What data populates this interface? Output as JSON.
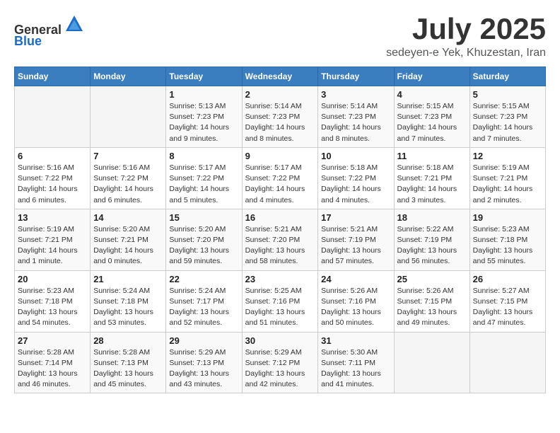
{
  "header": {
    "logo_line1": "General",
    "logo_line2": "Blue",
    "title": "July 2025",
    "subtitle": "sedeyen-e Yek, Khuzestan, Iran"
  },
  "calendar": {
    "days_of_week": [
      "Sunday",
      "Monday",
      "Tuesday",
      "Wednesday",
      "Thursday",
      "Friday",
      "Saturday"
    ],
    "weeks": [
      [
        {
          "day": "",
          "info": ""
        },
        {
          "day": "",
          "info": ""
        },
        {
          "day": "1",
          "info": "Sunrise: 5:13 AM\nSunset: 7:23 PM\nDaylight: 14 hours\nand 9 minutes."
        },
        {
          "day": "2",
          "info": "Sunrise: 5:14 AM\nSunset: 7:23 PM\nDaylight: 14 hours\nand 8 minutes."
        },
        {
          "day": "3",
          "info": "Sunrise: 5:14 AM\nSunset: 7:23 PM\nDaylight: 14 hours\nand 8 minutes."
        },
        {
          "day": "4",
          "info": "Sunrise: 5:15 AM\nSunset: 7:23 PM\nDaylight: 14 hours\nand 7 minutes."
        },
        {
          "day": "5",
          "info": "Sunrise: 5:15 AM\nSunset: 7:23 PM\nDaylight: 14 hours\nand 7 minutes."
        }
      ],
      [
        {
          "day": "6",
          "info": "Sunrise: 5:16 AM\nSunset: 7:22 PM\nDaylight: 14 hours\nand 6 minutes."
        },
        {
          "day": "7",
          "info": "Sunrise: 5:16 AM\nSunset: 7:22 PM\nDaylight: 14 hours\nand 6 minutes."
        },
        {
          "day": "8",
          "info": "Sunrise: 5:17 AM\nSunset: 7:22 PM\nDaylight: 14 hours\nand 5 minutes."
        },
        {
          "day": "9",
          "info": "Sunrise: 5:17 AM\nSunset: 7:22 PM\nDaylight: 14 hours\nand 4 minutes."
        },
        {
          "day": "10",
          "info": "Sunrise: 5:18 AM\nSunset: 7:22 PM\nDaylight: 14 hours\nand 4 minutes."
        },
        {
          "day": "11",
          "info": "Sunrise: 5:18 AM\nSunset: 7:21 PM\nDaylight: 14 hours\nand 3 minutes."
        },
        {
          "day": "12",
          "info": "Sunrise: 5:19 AM\nSunset: 7:21 PM\nDaylight: 14 hours\nand 2 minutes."
        }
      ],
      [
        {
          "day": "13",
          "info": "Sunrise: 5:19 AM\nSunset: 7:21 PM\nDaylight: 14 hours\nand 1 minute."
        },
        {
          "day": "14",
          "info": "Sunrise: 5:20 AM\nSunset: 7:21 PM\nDaylight: 14 hours\nand 0 minutes."
        },
        {
          "day": "15",
          "info": "Sunrise: 5:20 AM\nSunset: 7:20 PM\nDaylight: 13 hours\nand 59 minutes."
        },
        {
          "day": "16",
          "info": "Sunrise: 5:21 AM\nSunset: 7:20 PM\nDaylight: 13 hours\nand 58 minutes."
        },
        {
          "day": "17",
          "info": "Sunrise: 5:21 AM\nSunset: 7:19 PM\nDaylight: 13 hours\nand 57 minutes."
        },
        {
          "day": "18",
          "info": "Sunrise: 5:22 AM\nSunset: 7:19 PM\nDaylight: 13 hours\nand 56 minutes."
        },
        {
          "day": "19",
          "info": "Sunrise: 5:23 AM\nSunset: 7:18 PM\nDaylight: 13 hours\nand 55 minutes."
        }
      ],
      [
        {
          "day": "20",
          "info": "Sunrise: 5:23 AM\nSunset: 7:18 PM\nDaylight: 13 hours\nand 54 minutes."
        },
        {
          "day": "21",
          "info": "Sunrise: 5:24 AM\nSunset: 7:18 PM\nDaylight: 13 hours\nand 53 minutes."
        },
        {
          "day": "22",
          "info": "Sunrise: 5:24 AM\nSunset: 7:17 PM\nDaylight: 13 hours\nand 52 minutes."
        },
        {
          "day": "23",
          "info": "Sunrise: 5:25 AM\nSunset: 7:16 PM\nDaylight: 13 hours\nand 51 minutes."
        },
        {
          "day": "24",
          "info": "Sunrise: 5:26 AM\nSunset: 7:16 PM\nDaylight: 13 hours\nand 50 minutes."
        },
        {
          "day": "25",
          "info": "Sunrise: 5:26 AM\nSunset: 7:15 PM\nDaylight: 13 hours\nand 49 minutes."
        },
        {
          "day": "26",
          "info": "Sunrise: 5:27 AM\nSunset: 7:15 PM\nDaylight: 13 hours\nand 47 minutes."
        }
      ],
      [
        {
          "day": "27",
          "info": "Sunrise: 5:28 AM\nSunset: 7:14 PM\nDaylight: 13 hours\nand 46 minutes."
        },
        {
          "day": "28",
          "info": "Sunrise: 5:28 AM\nSunset: 7:13 PM\nDaylight: 13 hours\nand 45 minutes."
        },
        {
          "day": "29",
          "info": "Sunrise: 5:29 AM\nSunset: 7:13 PM\nDaylight: 13 hours\nand 43 minutes."
        },
        {
          "day": "30",
          "info": "Sunrise: 5:29 AM\nSunset: 7:12 PM\nDaylight: 13 hours\nand 42 minutes."
        },
        {
          "day": "31",
          "info": "Sunrise: 5:30 AM\nSunset: 7:11 PM\nDaylight: 13 hours\nand 41 minutes."
        },
        {
          "day": "",
          "info": ""
        },
        {
          "day": "",
          "info": ""
        }
      ]
    ]
  }
}
